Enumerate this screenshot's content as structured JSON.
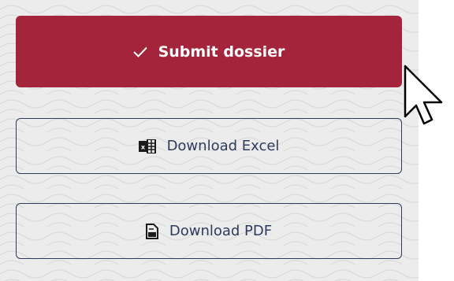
{
  "actions": {
    "submit_label": "Submit dossier",
    "excel_label": "Download Excel",
    "pdf_label": "Download PDF"
  },
  "icons": {
    "submit": "checkmark-icon",
    "excel": "excel-icon",
    "pdf": "pdf-file-icon",
    "cursor": "mouse-pointer-icon"
  },
  "colors": {
    "primary": "#a4243b",
    "outline": "#2f3b5c",
    "background": "#ececec"
  }
}
